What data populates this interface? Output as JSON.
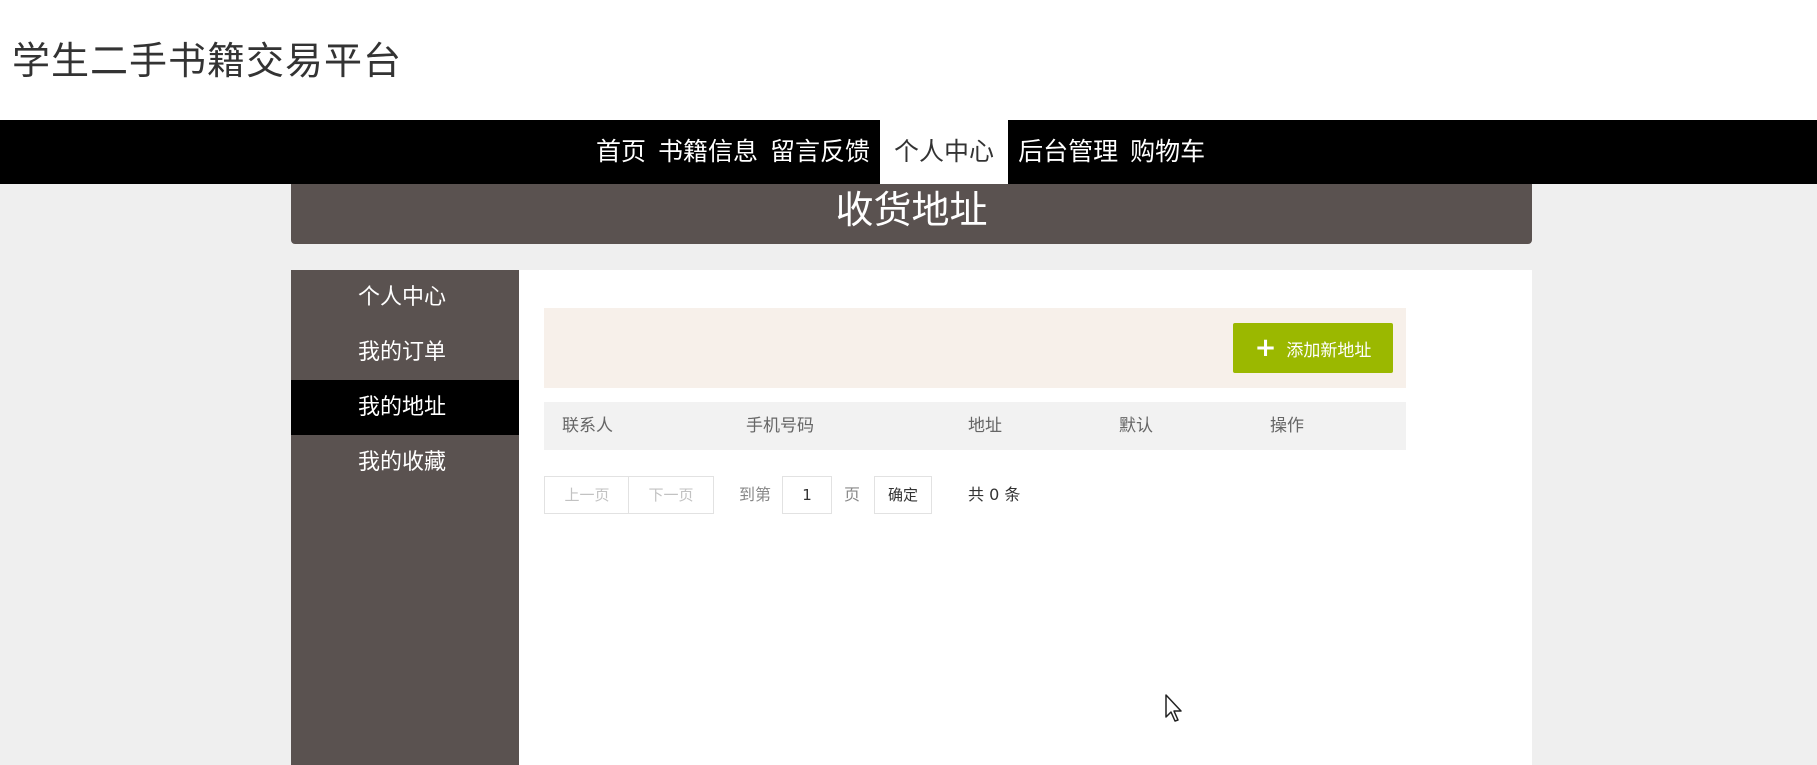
{
  "site": {
    "title": "学生二手书籍交易平台"
  },
  "nav": {
    "items": [
      {
        "label": "首页",
        "active": false
      },
      {
        "label": "书籍信息",
        "active": false
      },
      {
        "label": "留言反馈",
        "active": false
      },
      {
        "label": "个人中心",
        "active": true
      },
      {
        "label": "后台管理",
        "active": false
      },
      {
        "label": "购物车",
        "active": false
      }
    ]
  },
  "page": {
    "title": "收货地址"
  },
  "sidebar": {
    "items": [
      {
        "label": "个人中心",
        "active": false
      },
      {
        "label": "我的订单",
        "active": false
      },
      {
        "label": "我的地址",
        "active": true
      },
      {
        "label": "我的收藏",
        "active": false
      }
    ]
  },
  "toolbar": {
    "add_label": "添加新地址",
    "add_icon": "plus-icon",
    "accent_color": "#9bb800"
  },
  "table": {
    "columns": [
      "联系人",
      "手机号码",
      "地址",
      "默认",
      "操作"
    ],
    "rows": []
  },
  "pagination": {
    "prev_label": "上一页",
    "next_label": "下一页",
    "goto_prefix": "到第",
    "page_value": "1",
    "page_suffix": "页",
    "confirm_label": "确定",
    "total_text": "共 0 条"
  }
}
